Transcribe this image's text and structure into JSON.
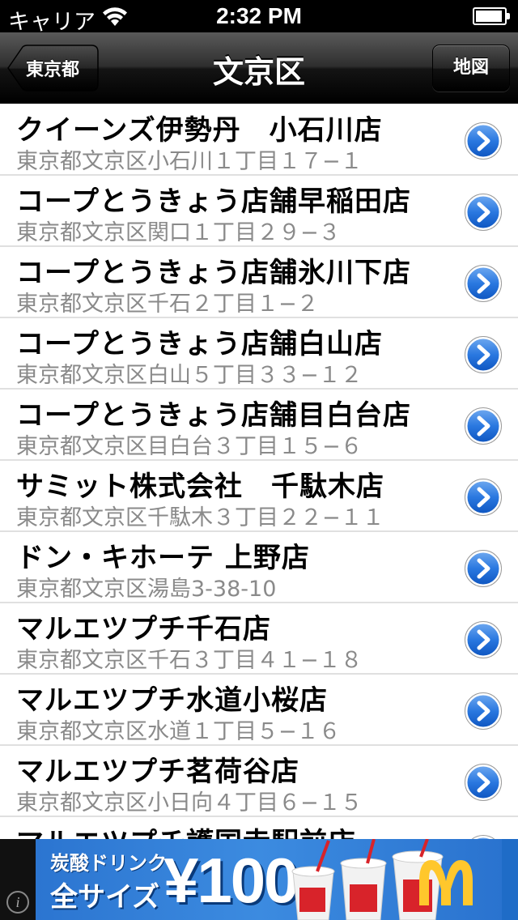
{
  "status_bar": {
    "carrier": "キャリア",
    "time": "2:32 PM",
    "battery_level": 0.95,
    "wifi_icon": "wifi-icon"
  },
  "nav": {
    "title": "文京区",
    "back_label": "東京都",
    "right_button_label": "地図"
  },
  "stores": [
    {
      "name": "クイーンズ伊勢丹　小石川店",
      "address": "東京都文京区小石川１丁目１７−１"
    },
    {
      "name": "コープとうきょう店舗早稲田店",
      "address": "東京都文京区関口１丁目２９−３"
    },
    {
      "name": "コープとうきょう店舗氷川下店",
      "address": "東京都文京区千石２丁目１−２"
    },
    {
      "name": "コープとうきょう店舗白山店",
      "address": "東京都文京区白山５丁目３３−１２"
    },
    {
      "name": "コープとうきょう店舗目白台店",
      "address": "東京都文京区目白台３丁目１５−６"
    },
    {
      "name": "サミット株式会社　千駄木店",
      "address": "東京都文京区千駄木３丁目２２−１１"
    },
    {
      "name": "ドン・キホーテ 上野店",
      "address": "東京都文京区湯島3-38-10"
    },
    {
      "name": "マルエツプチ千石店",
      "address": "東京都文京区千石３丁目４１−１８"
    },
    {
      "name": "マルエツプチ水道小桜店",
      "address": "東京都文京区水道１丁目５−１６"
    },
    {
      "name": "マルエツプチ茗荷谷店",
      "address": "東京都文京区小日向４丁目６−１５"
    },
    {
      "name": "マルエツプチ護国寺駅前店",
      "address": ""
    }
  ],
  "ad": {
    "line1": "炭酸ドリンク",
    "line2": "全サイズ",
    "price": "¥100",
    "colors": {
      "background": "#2a73cf",
      "logo_yellow": "#ffc72c",
      "cup_red": "#d8232a"
    }
  },
  "colors": {
    "accent": "#1a6fd6",
    "address_gray": "#8a8a8a",
    "separator": "#e0e0e0"
  }
}
